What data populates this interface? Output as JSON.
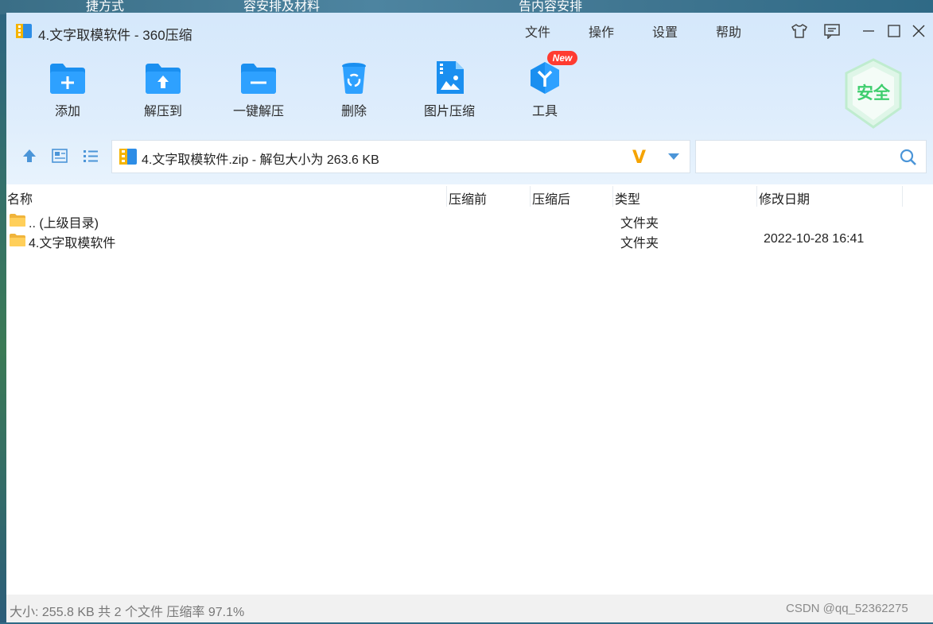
{
  "desktop": {
    "labels": [
      "捷方式",
      "容安排及材料",
      "告内容安排"
    ]
  },
  "window": {
    "title": "4.文字取模软件 - 360压缩",
    "menu": [
      "文件",
      "操作",
      "设置",
      "帮助"
    ]
  },
  "toolbar": {
    "items": [
      {
        "label": "添加",
        "icon": "add-folder-icon"
      },
      {
        "label": "解压到",
        "icon": "extract-to-icon"
      },
      {
        "label": "一键解压",
        "icon": "one-click-extract-icon"
      },
      {
        "label": "删除",
        "icon": "delete-icon"
      },
      {
        "label": "图片压缩",
        "icon": "image-compress-icon"
      },
      {
        "label": "工具",
        "icon": "tools-icon"
      }
    ],
    "new_badge": "New",
    "security_badge": "安全"
  },
  "pathbar": {
    "path_text": "4.文字取模软件.zip - 解包大小为 263.6 KB",
    "vip_glyph": "V"
  },
  "search": {
    "placeholder": "",
    "value": ""
  },
  "file_list": {
    "columns": [
      "名称",
      "压缩前",
      "压缩后",
      "类型",
      "修改日期"
    ],
    "rows": [
      {
        "name": ".. (上级目录)",
        "before": "",
        "after": "",
        "type": "文件夹",
        "modified": ""
      },
      {
        "name": "4.文字取模软件",
        "before": "",
        "after": "",
        "type": "文件夹",
        "modified": "2022-10-28 16:41"
      }
    ]
  },
  "status": {
    "text": "大小: 255.8 KB 共 2 个文件 压缩率 97.1%",
    "watermark": "CSDN @qq_52362275"
  },
  "colors": {
    "accent": "#1a8ff0",
    "header_bg": "#d5e8fb",
    "new_badge": "#ff3b30",
    "security_green": "#3fce6e",
    "vip_gold": "#f5a300"
  }
}
